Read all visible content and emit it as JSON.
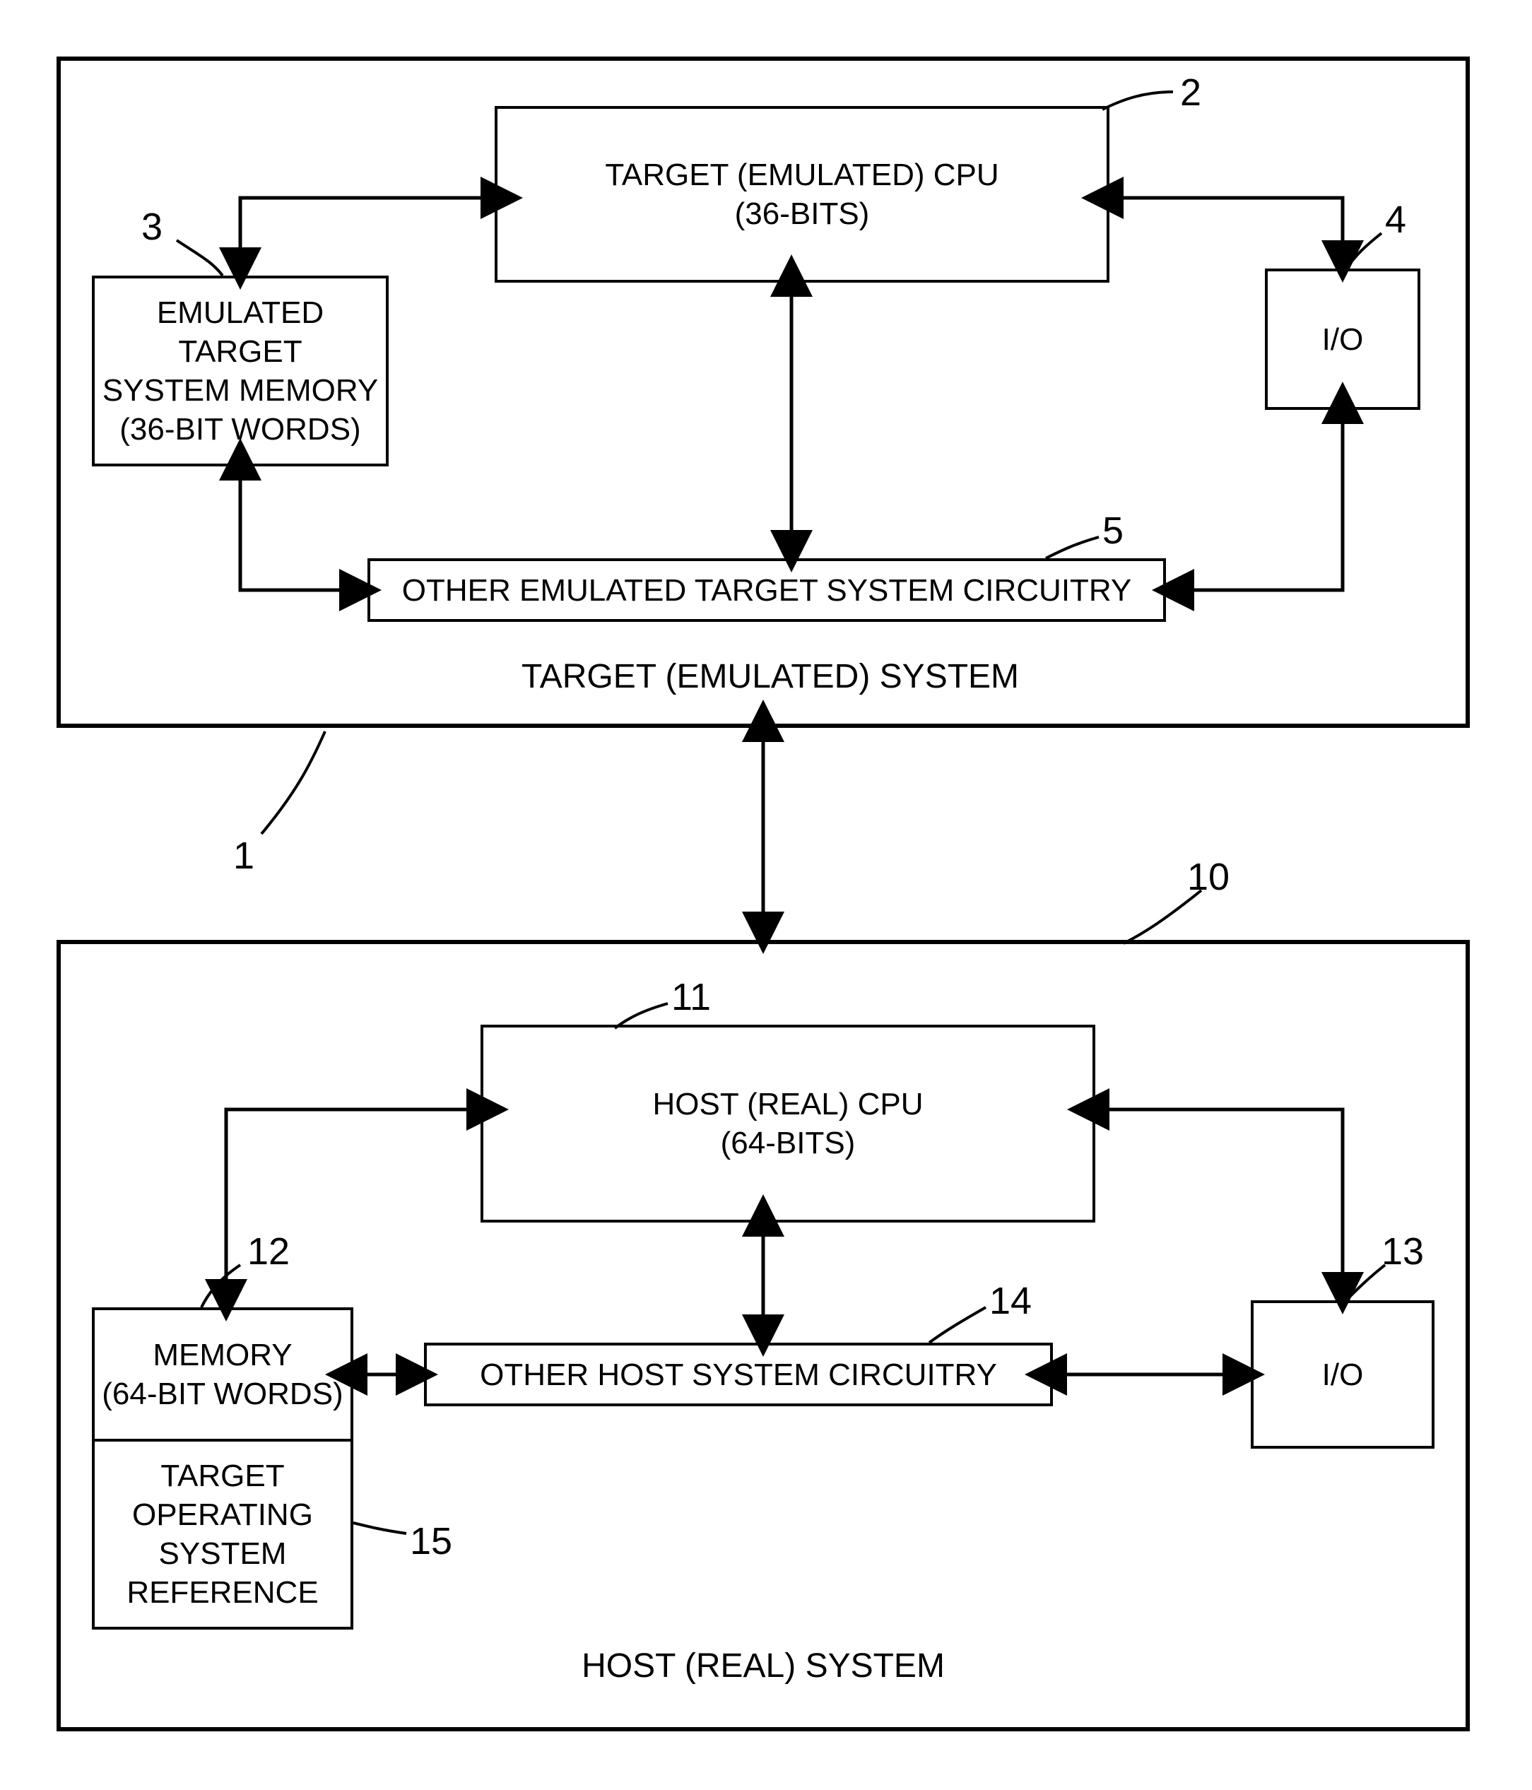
{
  "target_system": {
    "caption": "TARGET  (EMULATED)  SYSTEM",
    "cpu": "TARGET (EMULATED)  CPU\n(36-BITS)",
    "memory": "EMULATED TARGET\nSYSTEM MEMORY\n(36-BIT WORDS)",
    "io": "I/O",
    "circuitry": "OTHER EMULATED TARGET SYSTEM CIRCUITRY",
    "ref_system": "1",
    "ref_cpu": "2",
    "ref_memory": "3",
    "ref_io": "4",
    "ref_circuitry": "5"
  },
  "host_system": {
    "caption": "HOST (REAL)  SYSTEM",
    "cpu": "HOST (REAL) CPU\n(64-BITS)",
    "memory": "MEMORY\n(64-BIT WORDS)",
    "target_os_ref": "TARGET\nOPERATING\nSYSTEM\nREFERENCE",
    "io": "I/O",
    "circuitry": "OTHER HOST SYSTEM CIRCUITRY",
    "ref_system": "10",
    "ref_cpu": "11",
    "ref_memory": "12",
    "ref_io": "13",
    "ref_circuitry": "14",
    "ref_target_os": "15"
  }
}
